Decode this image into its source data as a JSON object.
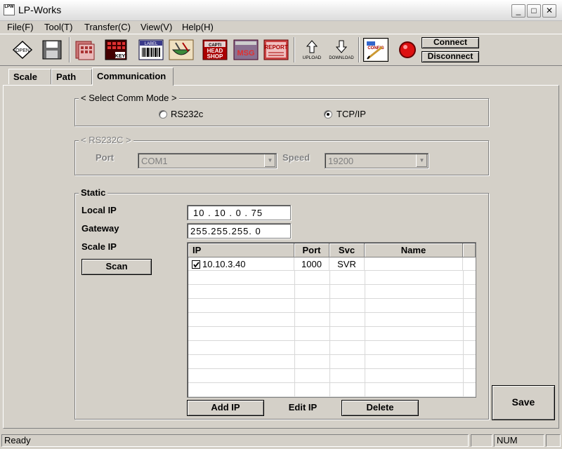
{
  "window": {
    "title": "LP-Works",
    "icon_text": "LPW",
    "minimize": "_",
    "maximize": "□",
    "close": "✕"
  },
  "menu": {
    "items": [
      {
        "label": "File(F)"
      },
      {
        "label": "Tool(T)"
      },
      {
        "label": "Transfer(C)"
      },
      {
        "label": "View(V)"
      },
      {
        "label": "Help(H)"
      }
    ]
  },
  "toolbar": {
    "open_text": "OPEN",
    "key_text": "KEY",
    "label_text": "LABEL",
    "headshop_line1": "CAPTI",
    "headshop_line2": "HEAD",
    "headshop_line3": "SHOP",
    "msg_text": "MSG",
    "report_text": "REPORT",
    "upload_text": "UPLOAD",
    "download_text": "DOWNLOAD",
    "config_text": "CONFIG",
    "connect_label": "Connect",
    "disconnect_label": "Disconnect",
    "accent_red": "#cc0000"
  },
  "tabs": [
    {
      "label": "Scale"
    },
    {
      "label": "Path"
    },
    {
      "label": "Communication"
    }
  ],
  "comm_mode": {
    "title": "< Select Comm Mode >",
    "rs232c_label": "RS232c",
    "tcpip_label": "TCP/IP",
    "selected": "TCP/IP"
  },
  "rs232c": {
    "title": "< RS232C >",
    "port_label": "Port",
    "port_value": "COM1",
    "speed_label": "Speed",
    "speed_value": "19200"
  },
  "static": {
    "title": "Static",
    "local_ip_label": "Local IP",
    "local_ip_value": "10 . 10 . 0 . 75",
    "gateway_label": "Gateway",
    "gateway_value": "255.255.255. 0",
    "scale_ip_label": "Scale IP",
    "scan_label": "Scan",
    "columns": [
      "IP",
      "Port",
      "Svc",
      "Name"
    ],
    "rows": [
      {
        "checked": true,
        "ip": "10.10.3.40",
        "port": "1000",
        "svc": "SVR",
        "name": ""
      }
    ],
    "add_ip_label": "Add IP",
    "edit_ip_label": "Edit IP",
    "delete_label": "Delete"
  },
  "save_label": "Save",
  "status": {
    "text": "Ready",
    "num": "NUM"
  }
}
